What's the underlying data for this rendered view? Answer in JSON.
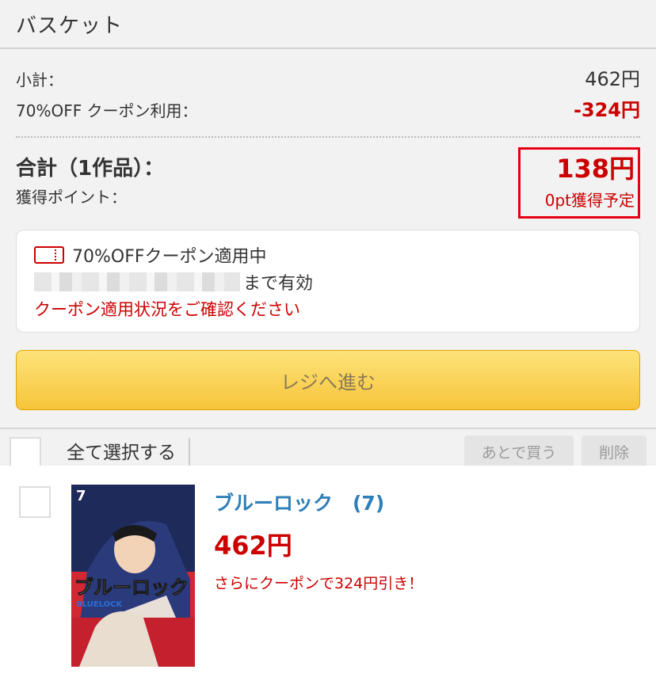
{
  "header": {
    "title": "バスケット"
  },
  "summary": {
    "subtotal_label": "小計：",
    "subtotal_value": "462円",
    "coupon_label": "70%OFF クーポン利用：",
    "coupon_value": "-324円",
    "total_label": "合計（1作品）：",
    "points_label": "獲得ポイント：",
    "total_value": "138円",
    "points_value": "0pt獲得予定"
  },
  "coupon_card": {
    "applied": "70%OFFクーポン適用中",
    "valid_until": "まで有効",
    "warning": "クーポン適用状況をご確認ください"
  },
  "checkout": {
    "label": "レジへ進む"
  },
  "select_bar": {
    "select_all": "全て選択する",
    "later_label": "あとで買う",
    "delete_label": "削除"
  },
  "item": {
    "title": "ブルーロック　(7)",
    "price": "462円",
    "promo": "さらにクーポンで324円引き！",
    "cover_volume": "7",
    "cover_title": "ブルーロック",
    "cover_subtitle": "BLUELOCK"
  },
  "colors": {
    "accent_red": "#cc0000",
    "title_blue": "#2f7fb8",
    "button_yellow": "#f6c43a"
  },
  "icons": [
    "coupon-ticket-icon"
  ]
}
